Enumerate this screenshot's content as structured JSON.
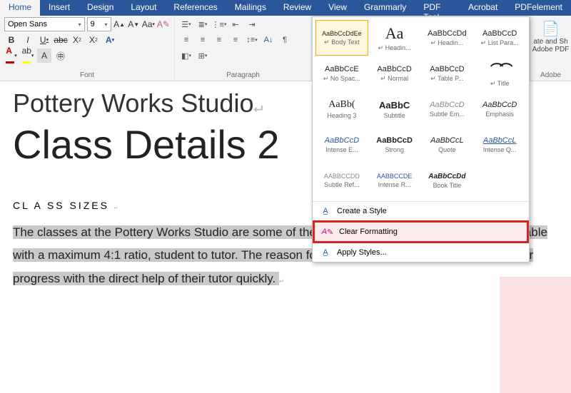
{
  "tabs": [
    "Home",
    "Insert",
    "Design",
    "Layout",
    "References",
    "Mailings",
    "Review",
    "View",
    "Grammarly",
    "PDF Tool Set",
    "Acrobat",
    "PDFelement"
  ],
  "activeTab": 0,
  "font": {
    "name": "Open Sans",
    "size": "9"
  },
  "groupLabels": {
    "font": "Font",
    "paragraph": "Paragraph"
  },
  "styles": [
    {
      "preview": "AaBbCcDdEe",
      "name": "↵ Body Text",
      "pstyle": "font-size:9px"
    },
    {
      "preview": "Aa",
      "name": "↵ Headin...",
      "pstyle": "font-size:22px;font-family:Georgia,serif"
    },
    {
      "preview": "AaBbCcDd",
      "name": "↵ Headin...",
      "pstyle": "font-size:11px"
    },
    {
      "preview": "AaBbCcD",
      "name": "↵ List Para...",
      "pstyle": "font-size:11px"
    },
    {
      "preview": "AaBbCcE",
      "name": "↵ No Spac...",
      "pstyle": "font-size:11px"
    },
    {
      "preview": "AaBbCcD",
      "name": "↵ Normal",
      "pstyle": "font-size:11px"
    },
    {
      "preview": "AaBbCcD",
      "name": "↵ Table P...",
      "pstyle": "font-size:11px"
    },
    {
      "preview": "⌒⌒",
      "name": "↵ Title",
      "pstyle": "font-size:18px;font-weight:bold;font-family:Georgia,serif;letter-spacing:-5px"
    },
    {
      "preview": "AaBb(",
      "name": "Heading 3",
      "pstyle": "font-size:14px;font-family:Georgia,serif"
    },
    {
      "preview": "AaBbC",
      "name": "Subtitle",
      "pstyle": "font-size:13px;font-weight:bold"
    },
    {
      "preview": "AaBbCcD",
      "name": "Subtle Em...",
      "pstyle": "font-size:11px;font-style:italic;color:#888"
    },
    {
      "preview": "AaBbCcD",
      "name": "Emphasis",
      "pstyle": "font-size:11px;font-style:italic"
    },
    {
      "preview": "AaBbCcD",
      "name": "Intense E...",
      "pstyle": "font-size:11px;font-style:italic;color:#2b579a"
    },
    {
      "preview": "AaBbCcD",
      "name": "Strong",
      "pstyle": "font-size:11px;font-weight:bold"
    },
    {
      "preview": "AaBbCcL",
      "name": "Quote",
      "pstyle": "font-size:11px;font-style:italic"
    },
    {
      "preview": "AaBbCcL",
      "name": "Intense Q...",
      "pstyle": "font-size:11px;font-style:italic;color:#2b579a;text-decoration:underline"
    },
    {
      "preview": "AABBCCDD",
      "name": "Subtle Ref...",
      "pstyle": "font-size:9px;color:#888"
    },
    {
      "preview": "AABBCCDE",
      "name": "Intense R...",
      "pstyle": "font-size:9px;color:#2b579a"
    },
    {
      "preview": "AaBbCcDd",
      "name": "Book Title",
      "pstyle": "font-size:10px;font-weight:bold;font-style:italic"
    }
  ],
  "stylesMenu": {
    "create": "Create a Style",
    "clear": "Clear Formatting",
    "apply": "Apply Styles..."
  },
  "adobe": {
    "line1": "ate and Sh",
    "line2": "Adobe PDF",
    "group": "Adobe"
  },
  "document": {
    "title1": "Pottery Works Studio",
    "title2": "Class Details 2",
    "heading": "CL A SS SIZES",
    "para": "The classes at the Pottery Works Studio are some of the smallest wheel- throwing classes available with a maximum 4:1 ratio, student to tutor. The reason for this is so that students can make faster progress with the direct help of their tutor quickly."
  }
}
